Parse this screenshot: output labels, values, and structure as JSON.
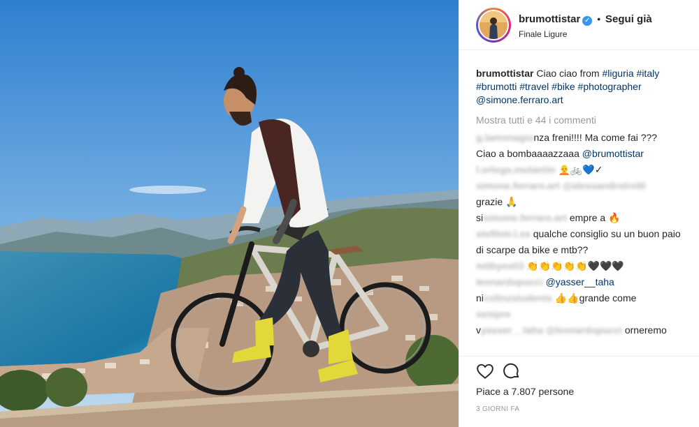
{
  "post": {
    "username": "brumottistar",
    "verified_mark": "✓",
    "separator": "•",
    "follow_label": "Segui già",
    "location": "Finale Ligure",
    "caption": {
      "username": "brumottistar",
      "text": "Ciao ciao from",
      "tags": [
        "#liguria",
        "#italy",
        "#brumotti",
        "#travel",
        "#bike",
        "#photographer",
        "@simone.ferraro.art"
      ]
    },
    "view_all_comments": "Mostra tutti e 44 i commenti",
    "comments": [
      {
        "user": "g.lamonagio",
        "pre": "",
        "text": "nza freni!!!! Ma come fai ???"
      },
      {
        "user": "",
        "pre": "",
        "text": "Ciao a bombaaaazzaaa",
        "mention": "@brumottistar"
      },
      {
        "user": "l.ortega.mutantin",
        "pre": "",
        "text": "🧑‍🦲🚲💙✓"
      },
      {
        "user": "simone.ferraro.art",
        "pre": "",
        "text": "",
        "mention": "@alessandrotrotti"
      },
      {
        "user": "",
        "pre": "",
        "text": "grazie 🙏"
      },
      {
        "user": "simone.ferraro.art",
        "pre": "si",
        "text": "empre a 🔥"
      },
      {
        "user": "stefilotr.l.ss",
        "pre": "",
        "text": "qualche consiglio su un buon paio di scarpe da bike e mtb??"
      },
      {
        "user": "mtlbyes03",
        "pre": "",
        "text": "👏👏👏👏👏🖤🖤🖤"
      },
      {
        "user": "leonardopucci",
        "pre": "",
        "text": "",
        "mention": "@yasser__taha"
      },
      {
        "user": "colinzstudents",
        "pre": "ni",
        "text": "👍👍grande come",
        "tail": "sempre"
      },
      {
        "user": "yasser__taha @leonardopucci",
        "pre": "v",
        "text": "orneremo"
      }
    ],
    "likes_label": "Piace a 7.807 persone",
    "date": "3 GIORNI FA"
  },
  "icons": {
    "like": "heart-icon",
    "comment": "comment-bubble-icon",
    "verified": "verified-badge-icon"
  },
  "colors": {
    "link": "#003569",
    "verified": "#3897f0",
    "muted": "#999999",
    "border": "#efefef"
  }
}
